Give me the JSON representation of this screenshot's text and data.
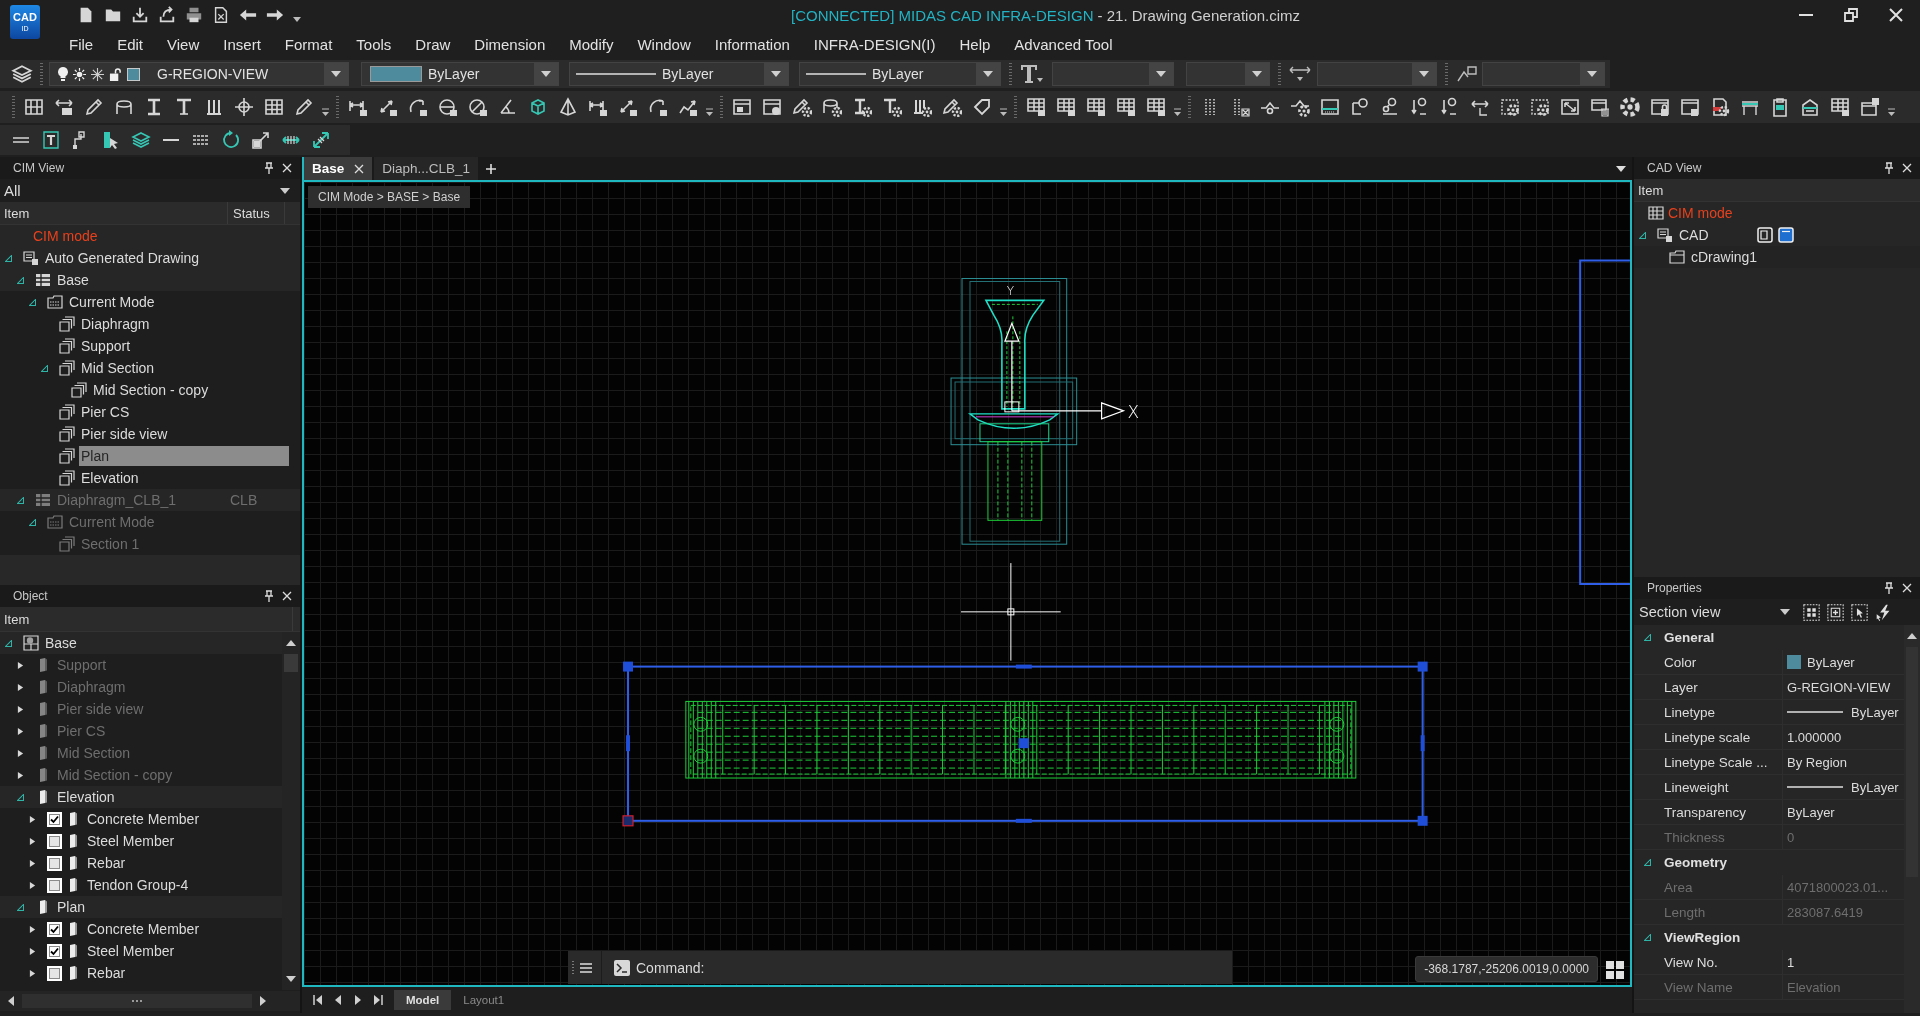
{
  "app_logo": {
    "text": "CAD",
    "subtext": "ID"
  },
  "window": {
    "status_title": "[CONNECTED] MIDAS CAD INFRA-DESIGN",
    "document_title": "- 21. Drawing Generation.cimz"
  },
  "menu": [
    "File",
    "Edit",
    "View",
    "Insert",
    "Format",
    "Tools",
    "Draw",
    "Dimension",
    "Modify",
    "Window",
    "Information",
    "INFRA-DESIGN(I)",
    "Help",
    "Advanced Tool"
  ],
  "layer_toolbar": {
    "layer": "G-REGION-VIEW",
    "color_setting": "ByLayer",
    "linetype": "ByLayer",
    "lineweight": "ByLayer"
  },
  "cim_view": {
    "title": "CIM View",
    "filter": "All",
    "columns": [
      "Item",
      "Status"
    ],
    "mode_label": "CIM mode",
    "tree": [
      {
        "label": "Auto Generated Drawing",
        "kind": "drawing-set",
        "expanded": true,
        "selected": false,
        "disabled": false,
        "children": [
          {
            "label": "Base",
            "kind": "table",
            "expanded": true,
            "selected": false,
            "disabled": false,
            "children": [
              {
                "label": "Current Mode",
                "kind": "mode",
                "expanded": true,
                "selected": false,
                "disabled": false,
                "children": [
                  {
                    "label": "Diaphragm",
                    "kind": "sheet",
                    "selected": false,
                    "disabled": false
                  },
                  {
                    "label": "Support",
                    "kind": "sheet",
                    "selected": false,
                    "disabled": false
                  },
                  {
                    "label": "Mid Section",
                    "kind": "sheet",
                    "expanded": true,
                    "selected": false,
                    "disabled": false,
                    "children": [
                      {
                        "label": "Mid Section - copy",
                        "kind": "sheet",
                        "selected": false,
                        "disabled": false
                      }
                    ]
                  },
                  {
                    "label": "Pier CS",
                    "kind": "sheet",
                    "selected": false,
                    "disabled": false
                  },
                  {
                    "label": "Pier side view",
                    "kind": "sheet",
                    "selected": false,
                    "disabled": false
                  },
                  {
                    "label": "Plan",
                    "kind": "sheet",
                    "selected": true,
                    "disabled": false
                  },
                  {
                    "label": "Elevation",
                    "kind": "sheet",
                    "selected": false,
                    "disabled": false
                  }
                ]
              }
            ]
          },
          {
            "label": "Diaphragm_CLB_1",
            "kind": "table",
            "status": "CLB",
            "expanded": true,
            "selected": false,
            "disabled": true,
            "children": [
              {
                "label": "Current Mode",
                "kind": "mode",
                "expanded": true,
                "selected": false,
                "disabled": true,
                "children": [
                  {
                    "label": "Section 1",
                    "kind": "sheet",
                    "selected": false,
                    "disabled": true
                  }
                ]
              }
            ]
          }
        ]
      }
    ]
  },
  "object_panel": {
    "title": "Object",
    "columns": [
      "Item"
    ],
    "tree": [
      {
        "label": "Base",
        "kind": "model",
        "expanded": true,
        "disabled": false,
        "children": [
          {
            "label": "Support",
            "kind": "member",
            "expanded": false,
            "disabled": true
          },
          {
            "label": "Diaphragm",
            "kind": "member",
            "expanded": false,
            "disabled": true
          },
          {
            "label": "Pier side view",
            "kind": "member",
            "expanded": false,
            "disabled": true
          },
          {
            "label": "Pier CS",
            "kind": "member",
            "expanded": false,
            "disabled": true
          },
          {
            "label": "Mid Section",
            "kind": "member",
            "expanded": false,
            "disabled": true
          },
          {
            "label": "Mid Section - copy",
            "kind": "member",
            "expanded": false,
            "disabled": true
          },
          {
            "label": "Elevation",
            "kind": "member",
            "expanded": true,
            "disabled": false,
            "children": [
              {
                "label": "Concrete Member",
                "kind": "member",
                "expanded": false,
                "checked": true,
                "disabled": false
              },
              {
                "label": "Steel Member",
                "kind": "member",
                "expanded": false,
                "checked": false,
                "disabled": false
              },
              {
                "label": "Rebar",
                "kind": "member",
                "expanded": false,
                "checked": false,
                "disabled": false
              },
              {
                "label": "Tendon Group-4",
                "kind": "member",
                "expanded": false,
                "checked": false,
                "disabled": false
              }
            ]
          },
          {
            "label": "Plan",
            "kind": "member",
            "expanded": true,
            "disabled": false,
            "children": [
              {
                "label": "Concrete Member",
                "kind": "member",
                "expanded": false,
                "checked": true,
                "disabled": false
              },
              {
                "label": "Steel Member",
                "kind": "member",
                "expanded": false,
                "checked": true,
                "disabled": false
              },
              {
                "label": "Rebar",
                "kind": "member",
                "expanded": false,
                "checked": false,
                "disabled": false
              }
            ]
          }
        ]
      }
    ]
  },
  "document_tabs": [
    {
      "label": "Base",
      "selected": true
    },
    {
      "label": "Diaph...CLB_1",
      "selected": false
    }
  ],
  "breadcrumb": "CIM Mode > BASE > Base",
  "canvas": {
    "axis_x": "X",
    "axis_y": "Y"
  },
  "command_line": {
    "prompt": "Command:"
  },
  "coordinates": "-368.1787,-25206.0019,0.0000",
  "layout_tabs": [
    {
      "label": "Model",
      "selected": true
    },
    {
      "label": "Layout1",
      "selected": false
    }
  ],
  "cad_view": {
    "title": "CAD View",
    "columns": [
      "Item"
    ],
    "mode_label": "CIM mode",
    "tree": [
      {
        "label": "CAD",
        "kind": "cad",
        "expanded": true,
        "toggles": [
          {
            "selected": false
          },
          {
            "selected": true
          }
        ],
        "children": [
          {
            "label": "cDrawing1",
            "kind": "folder"
          }
        ]
      }
    ]
  },
  "properties": {
    "title": "Properties",
    "selector": "Section view",
    "sections": [
      {
        "title": "General",
        "expanded": true,
        "rows": [
          {
            "name": "Color",
            "value": "ByLayer",
            "kind": "swatch",
            "disabled": false
          },
          {
            "name": "Layer",
            "value": "G-REGION-VIEW",
            "kind": "text",
            "disabled": false
          },
          {
            "name": "Linetype",
            "value": "ByLayer",
            "kind": "line",
            "disabled": false
          },
          {
            "name": "Linetype scale",
            "value": "1.000000",
            "kind": "text",
            "disabled": false
          },
          {
            "name": "Linetype Scale ...",
            "value": "By Region",
            "kind": "text",
            "disabled": false
          },
          {
            "name": "Lineweight",
            "value": "ByLayer",
            "kind": "line",
            "disabled": false
          },
          {
            "name": "Transparency",
            "value": "ByLayer",
            "kind": "text",
            "disabled": false
          },
          {
            "name": "Thickness",
            "value": "0",
            "kind": "text",
            "disabled": true
          }
        ]
      },
      {
        "title": "Geometry",
        "expanded": true,
        "rows": [
          {
            "name": "Area",
            "value": "4071800023.01...",
            "kind": "text",
            "disabled": true
          },
          {
            "name": "Length",
            "value": "283087.6419",
            "kind": "text",
            "disabled": true
          }
        ]
      },
      {
        "title": "ViewRegion",
        "expanded": true,
        "rows": [
          {
            "name": "View No.",
            "value": "1",
            "kind": "text",
            "disabled": false
          },
          {
            "name": "View Name",
            "value": "Elevation",
            "kind": "text",
            "disabled": true
          }
        ]
      }
    ]
  }
}
